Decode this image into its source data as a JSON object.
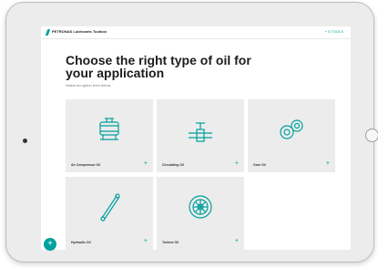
{
  "app": {
    "name": "PETRONAS Lubricants Toolbox",
    "top_action": "+ 5 TOOLS"
  },
  "main": {
    "title": "Choose the right type of oil for your application",
    "subtitle": "Select an option from below"
  },
  "cards": [
    {
      "label": "Air Compressor Oil",
      "icon": "air-compressor-icon"
    },
    {
      "label": "Circulating Oil",
      "icon": "valve-pipe-icon"
    },
    {
      "label": "Gear Oil",
      "icon": "gears-icon"
    },
    {
      "label": "Hydraulic Oil",
      "icon": "hydraulic-cylinder-icon"
    },
    {
      "label": "Turbine Oil",
      "icon": "turbine-icon"
    }
  ],
  "card_plus": "+",
  "fab": {
    "label": "+"
  },
  "colors": {
    "accent": "#00a19c",
    "card_bg": "#ececec",
    "text": "#1c1c1c"
  }
}
